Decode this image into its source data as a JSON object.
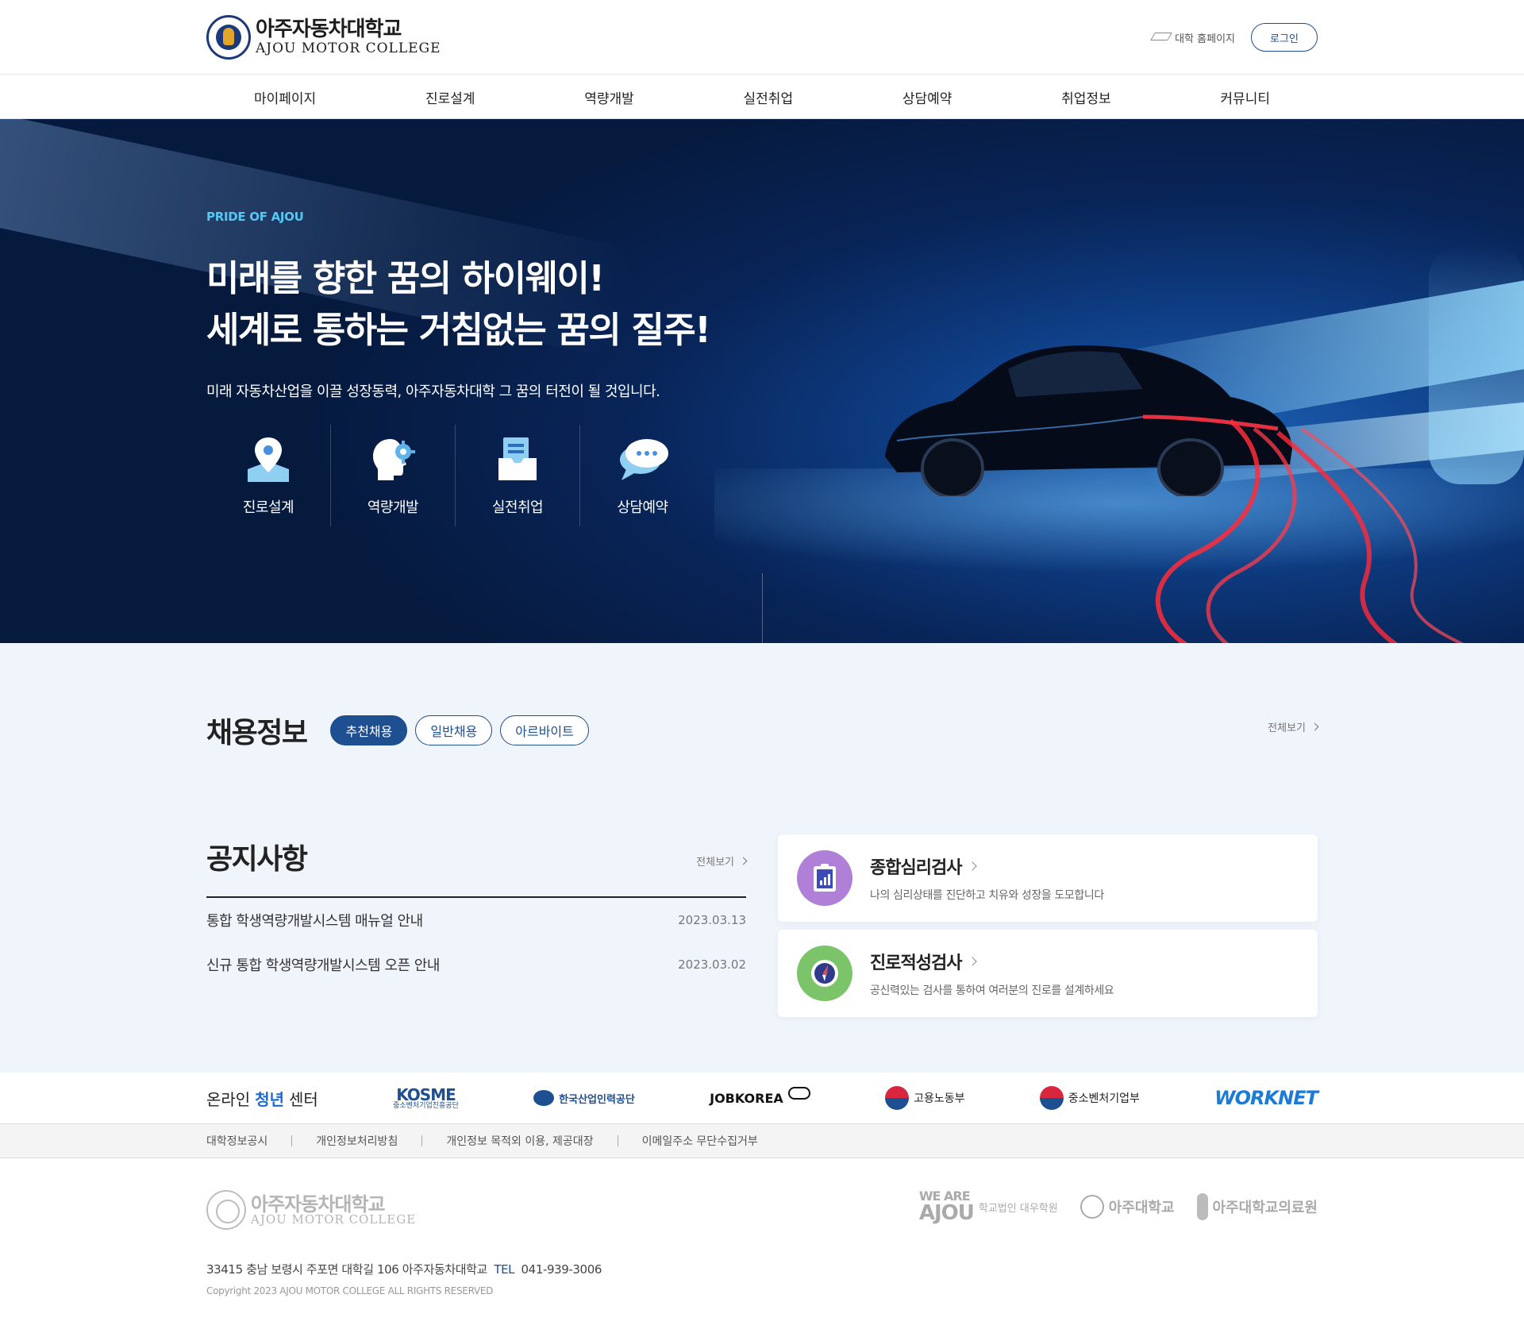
{
  "header": {
    "logo_ko": "아주자동차대학교",
    "logo_en": "AJOU MOTOR COLLEGE",
    "home_link": "대학 홈페이지",
    "login": "로그인"
  },
  "nav": [
    "마이페이지",
    "진로설계",
    "역량개발",
    "실전취업",
    "상담예약",
    "취업정보",
    "커뮤니티"
  ],
  "hero": {
    "eyebrow": "PRIDE OF AJOU",
    "line1": "미래를 향한 꿈의 하이웨이!",
    "line2": "세계로 통하는 거침없는 꿈의 질주!",
    "sub": "미래 자동차산업을 이끌 성장동력, 아주자동차대학 그 꿈의 터전이 될 것입니다.",
    "quick": [
      {
        "label": "진로설계",
        "icon": "map-pin-icon"
      },
      {
        "label": "역량개발",
        "icon": "head-gear-icon"
      },
      {
        "label": "실전취업",
        "icon": "document-box-icon"
      },
      {
        "label": "상담예약",
        "icon": "chat-bubble-icon"
      }
    ]
  },
  "recruit": {
    "title": "채용정보",
    "tabs": [
      "추천채용",
      "일반채용",
      "아르바이트"
    ],
    "active_tab": "추천채용",
    "more": "전체보기"
  },
  "notice": {
    "title": "공지사항",
    "more": "전체보기",
    "items": [
      {
        "title": "통합 학생역량개발시스템 매뉴얼 안내",
        "date": "2023.03.13"
      },
      {
        "title": "신규 통합 학생역량개발시스템 오픈 안내",
        "date": "2023.03.02"
      }
    ]
  },
  "tests": [
    {
      "title": "종합심리검사",
      "desc": "나의 심리상태를 진단하고 치유와 성장을 도모합니다",
      "color": "#b07fd8",
      "icon": "clipboard-chart-icon"
    },
    {
      "title": "진로적성검사",
      "desc": "공신력있는 검사를 통하여 여러분의 진로를 설계하세요",
      "color": "#7cc46a",
      "icon": "compass-icon"
    }
  ],
  "partners": {
    "youth": [
      "온라인 ",
      "청년",
      " 센터"
    ],
    "kosme": "KOSME",
    "kosme_sub": "중소벤처기업진흥공단",
    "hrdk": "한국산업인력공단",
    "jobkorea": "JOBKOREA",
    "moel": "고용노동부",
    "mss": "중소벤처기업부",
    "worknet": "WORKNET"
  },
  "links": [
    "대학정보공시",
    "개인정보처리방침",
    "개인정보 목적외 이용, 제공대장",
    "이메일주소 무단수집거부"
  ],
  "footer": {
    "logo_ko": "아주자동차대학교",
    "logo_en": "AJOU MOTOR COLLEGE",
    "we_are": "WE ARE",
    "ajou": "AJOU",
    "school_corp": "학교법인 대우학원",
    "ajou_univ": "아주대학교",
    "ajou_med": "아주대학교의료원",
    "address": "33415 충남 보령시 주포면 대학길 106 아주자동차대학교",
    "tel_label": "TEL",
    "tel": "041-939-3006",
    "copyright": "Copyright 2023 AJOU MOTOR COLLEGE ALL RIGHTS RESERVED"
  },
  "colors": {
    "brand": "#1d4f91",
    "accent": "#53c8f5",
    "page_bg": "#f0f4fb"
  }
}
